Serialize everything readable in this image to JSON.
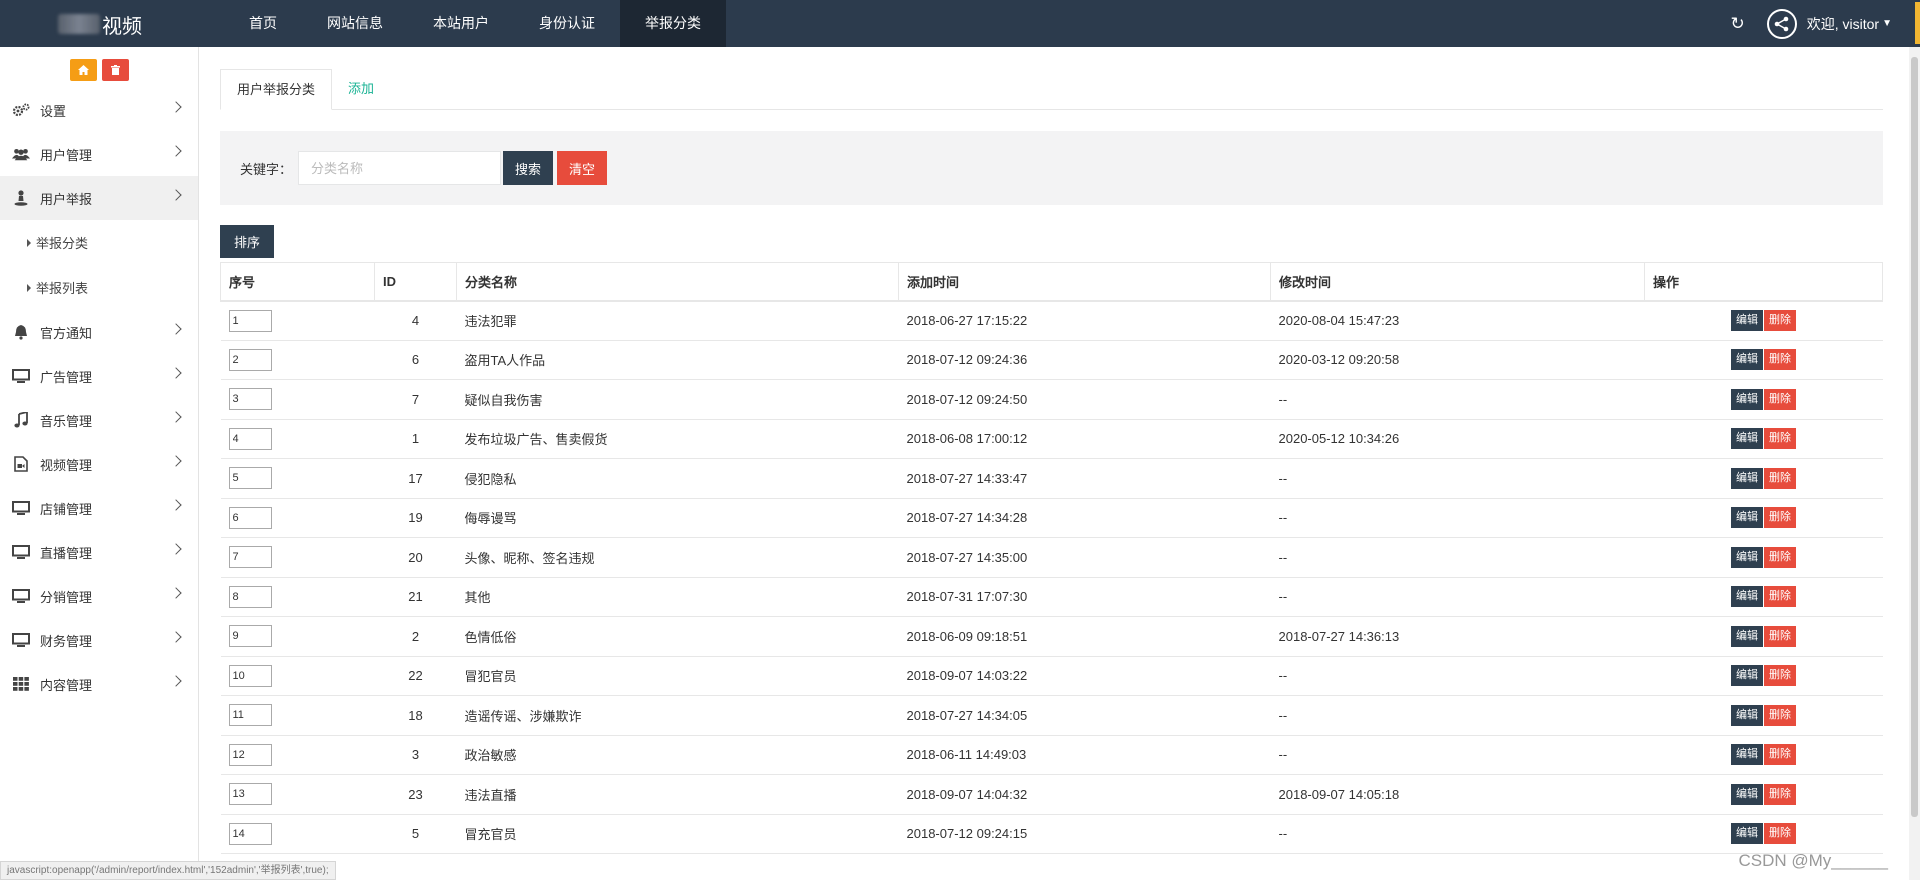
{
  "header": {
    "logo_text": "视频",
    "nav": [
      {
        "label": "首页",
        "active": false
      },
      {
        "label": "网站信息",
        "active": false
      },
      {
        "label": "本站用户",
        "active": false
      },
      {
        "label": "身份认证",
        "active": false
      },
      {
        "label": "举报分类",
        "active": true
      }
    ],
    "welcome": "欢迎, visitor",
    "icons": {
      "refresh": "refresh-icon",
      "avatar": "share-node-icon",
      "caret": "caret-down-icon"
    }
  },
  "sidebar": {
    "quick": [
      {
        "icon": "home-icon",
        "color": "#f59d15"
      },
      {
        "icon": "trash-icon",
        "color": "#e74c3c"
      }
    ],
    "items": [
      {
        "label": "设置",
        "icon": "gears-icon"
      },
      {
        "label": "用户管理",
        "icon": "users-icon"
      },
      {
        "label": "用户举报",
        "icon": "user-report-icon",
        "active": true
      },
      {
        "label": "官方通知",
        "icon": "bell-icon"
      },
      {
        "label": "广告管理",
        "icon": "monitor-icon"
      },
      {
        "label": "音乐管理",
        "icon": "music-icon"
      },
      {
        "label": "视频管理",
        "icon": "video-file-icon"
      },
      {
        "label": "店铺管理",
        "icon": "monitor-icon"
      },
      {
        "label": "直播管理",
        "icon": "monitor-icon"
      },
      {
        "label": "分销管理",
        "icon": "monitor-icon"
      },
      {
        "label": "财务管理",
        "icon": "monitor-icon"
      },
      {
        "label": "内容管理",
        "icon": "grid-icon"
      }
    ],
    "sub_items": [
      "举报分类",
      "举报列表"
    ]
  },
  "tabs": [
    "用户举报分类",
    "添加"
  ],
  "search": {
    "label": "关键字：",
    "placeholder": "分类名称",
    "search_label": "搜索",
    "clear_label": "清空"
  },
  "sort_label": "排序",
  "table": {
    "headers": [
      "序号",
      "ID",
      "分类名称",
      "添加时间",
      "修改时间",
      "操作"
    ],
    "edit_label": "编辑",
    "delete_label": "删除",
    "rows": [
      {
        "order": "1",
        "id": "4",
        "name": "违法犯罪",
        "added": "2018-06-27 17:15:22",
        "modified": "2020-08-04 15:47:23"
      },
      {
        "order": "2",
        "id": "6",
        "name": "盗用TA人作品",
        "added": "2018-07-12 09:24:36",
        "modified": "2020-03-12 09:20:58"
      },
      {
        "order": "3",
        "id": "7",
        "name": "疑似自我伤害",
        "added": "2018-07-12 09:24:50",
        "modified": "--"
      },
      {
        "order": "4",
        "id": "1",
        "name": "发布垃圾广告、售卖假货",
        "added": "2018-06-08 17:00:12",
        "modified": "2020-05-12 10:34:26"
      },
      {
        "order": "5",
        "id": "17",
        "name": "侵犯隐私",
        "added": "2018-07-27 14:33:47",
        "modified": "--"
      },
      {
        "order": "6",
        "id": "19",
        "name": "侮辱谩骂",
        "added": "2018-07-27 14:34:28",
        "modified": "--"
      },
      {
        "order": "7",
        "id": "20",
        "name": "头像、昵称、签名违规",
        "added": "2018-07-27 14:35:00",
        "modified": "--"
      },
      {
        "order": "8",
        "id": "21",
        "name": "其他",
        "added": "2018-07-31 17:07:30",
        "modified": "--"
      },
      {
        "order": "9",
        "id": "2",
        "name": "色情低俗",
        "added": "2018-06-09 09:18:51",
        "modified": "2018-07-27 14:36:13"
      },
      {
        "order": "10",
        "id": "22",
        "name": "冒犯官员",
        "added": "2018-09-07 14:03:22",
        "modified": "--"
      },
      {
        "order": "11",
        "id": "18",
        "name": "造谣传谣、涉嫌欺诈",
        "added": "2018-07-27 14:34:05",
        "modified": "--"
      },
      {
        "order": "12",
        "id": "3",
        "name": "政治敏感",
        "added": "2018-06-11 14:49:03",
        "modified": "--"
      },
      {
        "order": "13",
        "id": "23",
        "name": "违法直播",
        "added": "2018-09-07 14:04:32",
        "modified": "2018-09-07 14:05:18"
      },
      {
        "order": "14",
        "id": "5",
        "name": "冒充官员",
        "added": "2018-07-12 09:24:15",
        "modified": "--"
      }
    ]
  },
  "statusbar": "javascript:openapp('/admin/report/index.html','152admin','举报列表',true);",
  "watermark": "CSDN @My______"
}
